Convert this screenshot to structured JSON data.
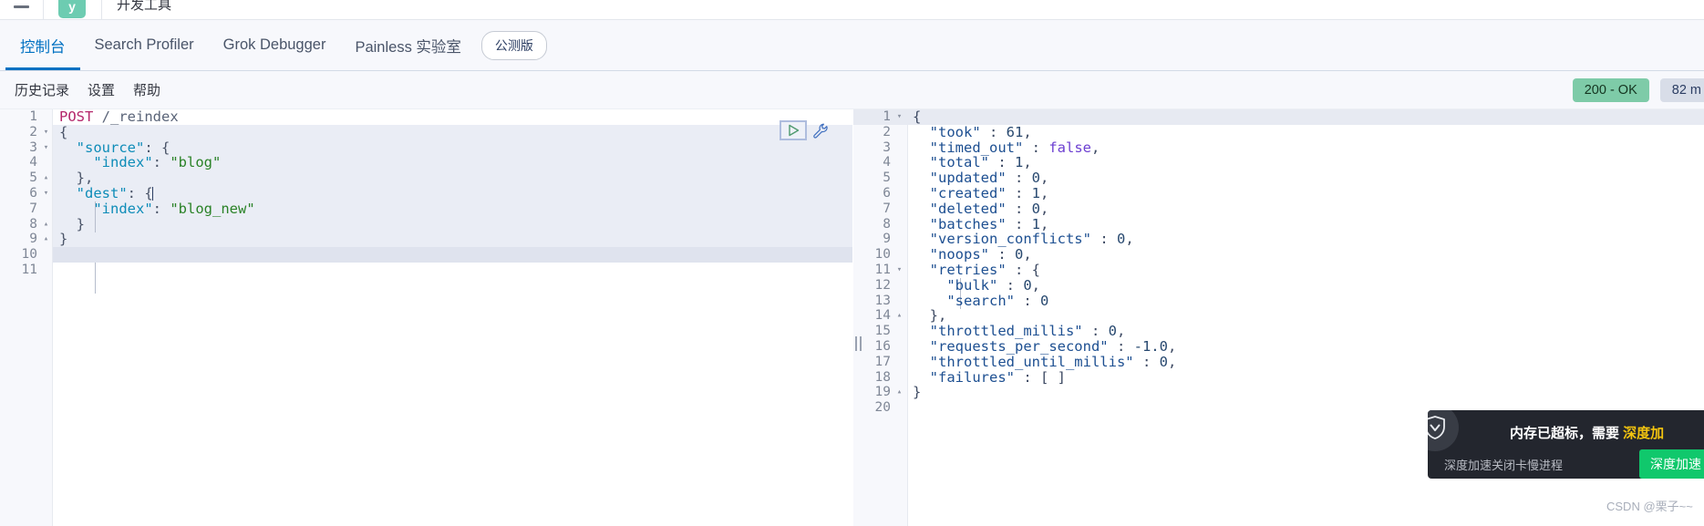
{
  "chrome": {
    "menu_icon": "hamburger-icon",
    "logo_letter": "y",
    "app_title": "开发工具"
  },
  "tabs": [
    {
      "label": "控制台",
      "active": true
    },
    {
      "label": "Search Profiler",
      "active": false
    },
    {
      "label": "Grok Debugger",
      "active": false
    },
    {
      "label": "Painless 实验室",
      "active": false
    }
  ],
  "beta_pill": "公测版",
  "submenu": [
    {
      "label": "历史记录"
    },
    {
      "label": "设置"
    },
    {
      "label": "帮助"
    }
  ],
  "status": {
    "code": "200 - OK",
    "time": "82 m",
    "badge_color": "#7ecba8"
  },
  "request_editor": {
    "play_icon": "play-icon",
    "wrench_icon": "wrench-icon",
    "line_count": 11,
    "current_line": 6,
    "lines": [
      {
        "n": "1",
        "fold": "",
        "tokens": [
          {
            "t": "POST",
            "c": "k-method"
          },
          {
            "t": " ",
            "c": "k-punct"
          },
          {
            "t": "/_reindex",
            "c": "k-path"
          }
        ]
      },
      {
        "n": "2",
        "fold": "▾",
        "tokens": [
          {
            "t": "{",
            "c": "k-punct"
          }
        ]
      },
      {
        "n": "3",
        "fold": "▾",
        "tokens": [
          {
            "t": "  ",
            "c": "k-punct"
          },
          {
            "t": "\"source\"",
            "c": "k-key"
          },
          {
            "t": ": {",
            "c": "k-punct"
          }
        ]
      },
      {
        "n": "4",
        "fold": "",
        "tokens": [
          {
            "t": "    ",
            "c": "k-punct"
          },
          {
            "t": "\"index\"",
            "c": "k-key"
          },
          {
            "t": ": ",
            "c": "k-punct"
          },
          {
            "t": "\"blog\"",
            "c": "k-str"
          }
        ]
      },
      {
        "n": "5",
        "fold": "▴",
        "tokens": [
          {
            "t": "  },",
            "c": "k-punct"
          }
        ]
      },
      {
        "n": "6",
        "fold": "▾",
        "tokens": [
          {
            "t": "  ",
            "c": "k-punct"
          },
          {
            "t": "\"dest\"",
            "c": "k-key"
          },
          {
            "t": ": {",
            "c": "k-punct"
          }
        ]
      },
      {
        "n": "7",
        "fold": "",
        "tokens": [
          {
            "t": "    ",
            "c": "k-punct"
          },
          {
            "t": "\"index\"",
            "c": "k-key"
          },
          {
            "t": ": ",
            "c": "k-punct"
          },
          {
            "t": "\"blog_new\"",
            "c": "k-str"
          }
        ]
      },
      {
        "n": "8",
        "fold": "▴",
        "tokens": [
          {
            "t": "  }",
            "c": "k-punct"
          }
        ]
      },
      {
        "n": "9",
        "fold": "▴",
        "tokens": [
          {
            "t": "}",
            "c": "k-punct"
          }
        ]
      },
      {
        "n": "10",
        "fold": "",
        "tokens": []
      },
      {
        "n": "11",
        "fold": "",
        "tokens": []
      }
    ]
  },
  "response_editor": {
    "line_count": 20,
    "lines": [
      {
        "n": "1",
        "fold": "▾",
        "tokens": [
          {
            "t": "{",
            "c": "r-punct"
          }
        ]
      },
      {
        "n": "2",
        "fold": "",
        "tokens": [
          {
            "t": "  ",
            "c": "r-punct"
          },
          {
            "t": "\"took\"",
            "c": "r-key"
          },
          {
            "t": " : ",
            "c": "r-punct"
          },
          {
            "t": "61",
            "c": "r-num"
          },
          {
            "t": ",",
            "c": "r-punct"
          }
        ]
      },
      {
        "n": "3",
        "fold": "",
        "tokens": [
          {
            "t": "  ",
            "c": "r-punct"
          },
          {
            "t": "\"timed_out\"",
            "c": "r-key"
          },
          {
            "t": " : ",
            "c": "r-punct"
          },
          {
            "t": "false",
            "c": "r-bool"
          },
          {
            "t": ",",
            "c": "r-punct"
          }
        ]
      },
      {
        "n": "4",
        "fold": "",
        "tokens": [
          {
            "t": "  ",
            "c": "r-punct"
          },
          {
            "t": "\"total\"",
            "c": "r-key"
          },
          {
            "t": " : ",
            "c": "r-punct"
          },
          {
            "t": "1",
            "c": "r-num"
          },
          {
            "t": ",",
            "c": "r-punct"
          }
        ]
      },
      {
        "n": "5",
        "fold": "",
        "tokens": [
          {
            "t": "  ",
            "c": "r-punct"
          },
          {
            "t": "\"updated\"",
            "c": "r-key"
          },
          {
            "t": " : ",
            "c": "r-punct"
          },
          {
            "t": "0",
            "c": "r-num"
          },
          {
            "t": ",",
            "c": "r-punct"
          }
        ]
      },
      {
        "n": "6",
        "fold": "",
        "tokens": [
          {
            "t": "  ",
            "c": "r-punct"
          },
          {
            "t": "\"created\"",
            "c": "r-key"
          },
          {
            "t": " : ",
            "c": "r-punct"
          },
          {
            "t": "1",
            "c": "r-num"
          },
          {
            "t": ",",
            "c": "r-punct"
          }
        ]
      },
      {
        "n": "7",
        "fold": "",
        "tokens": [
          {
            "t": "  ",
            "c": "r-punct"
          },
          {
            "t": "\"deleted\"",
            "c": "r-key"
          },
          {
            "t": " : ",
            "c": "r-punct"
          },
          {
            "t": "0",
            "c": "r-num"
          },
          {
            "t": ",",
            "c": "r-punct"
          }
        ]
      },
      {
        "n": "8",
        "fold": "",
        "tokens": [
          {
            "t": "  ",
            "c": "r-punct"
          },
          {
            "t": "\"batches\"",
            "c": "r-key"
          },
          {
            "t": " : ",
            "c": "r-punct"
          },
          {
            "t": "1",
            "c": "r-num"
          },
          {
            "t": ",",
            "c": "r-punct"
          }
        ]
      },
      {
        "n": "9",
        "fold": "",
        "tokens": [
          {
            "t": "  ",
            "c": "r-punct"
          },
          {
            "t": "\"version_conflicts\"",
            "c": "r-key"
          },
          {
            "t": " : ",
            "c": "r-punct"
          },
          {
            "t": "0",
            "c": "r-num"
          },
          {
            "t": ",",
            "c": "r-punct"
          }
        ]
      },
      {
        "n": "10",
        "fold": "",
        "tokens": [
          {
            "t": "  ",
            "c": "r-punct"
          },
          {
            "t": "\"noops\"",
            "c": "r-key"
          },
          {
            "t": " : ",
            "c": "r-punct"
          },
          {
            "t": "0",
            "c": "r-num"
          },
          {
            "t": ",",
            "c": "r-punct"
          }
        ]
      },
      {
        "n": "11",
        "fold": "▾",
        "tokens": [
          {
            "t": "  ",
            "c": "r-punct"
          },
          {
            "t": "\"retries\"",
            "c": "r-key"
          },
          {
            "t": " : {",
            "c": "r-punct"
          }
        ]
      },
      {
        "n": "12",
        "fold": "",
        "tokens": [
          {
            "t": "    ",
            "c": "r-punct"
          },
          {
            "t": "\"bulk\"",
            "c": "r-key"
          },
          {
            "t": " : ",
            "c": "r-punct"
          },
          {
            "t": "0",
            "c": "r-num"
          },
          {
            "t": ",",
            "c": "r-punct"
          }
        ]
      },
      {
        "n": "13",
        "fold": "",
        "tokens": [
          {
            "t": "    ",
            "c": "r-punct"
          },
          {
            "t": "\"search\"",
            "c": "r-key"
          },
          {
            "t": " : ",
            "c": "r-punct"
          },
          {
            "t": "0",
            "c": "r-num"
          }
        ]
      },
      {
        "n": "14",
        "fold": "▴",
        "tokens": [
          {
            "t": "  },",
            "c": "r-punct"
          }
        ]
      },
      {
        "n": "15",
        "fold": "",
        "tokens": [
          {
            "t": "  ",
            "c": "r-punct"
          },
          {
            "t": "\"throttled_millis\"",
            "c": "r-key"
          },
          {
            "t": " : ",
            "c": "r-punct"
          },
          {
            "t": "0",
            "c": "r-num"
          },
          {
            "t": ",",
            "c": "r-punct"
          }
        ]
      },
      {
        "n": "16",
        "fold": "",
        "tokens": [
          {
            "t": "  ",
            "c": "r-punct"
          },
          {
            "t": "\"requests_per_second\"",
            "c": "r-key"
          },
          {
            "t": " : ",
            "c": "r-punct"
          },
          {
            "t": "-1.0",
            "c": "r-num"
          },
          {
            "t": ",",
            "c": "r-punct"
          }
        ]
      },
      {
        "n": "17",
        "fold": "",
        "tokens": [
          {
            "t": "  ",
            "c": "r-punct"
          },
          {
            "t": "\"throttled_until_millis\"",
            "c": "r-key"
          },
          {
            "t": " : ",
            "c": "r-punct"
          },
          {
            "t": "0",
            "c": "r-num"
          },
          {
            "t": ",",
            "c": "r-punct"
          }
        ]
      },
      {
        "n": "18",
        "fold": "",
        "tokens": [
          {
            "t": "  ",
            "c": "r-punct"
          },
          {
            "t": "\"failures\"",
            "c": "r-key"
          },
          {
            "t": " : [ ]",
            "c": "r-punct"
          }
        ]
      },
      {
        "n": "19",
        "fold": "▴",
        "tokens": [
          {
            "t": "}",
            "c": "r-punct"
          }
        ]
      },
      {
        "n": "20",
        "fold": "",
        "tokens": []
      }
    ]
  },
  "toast": {
    "icon": "shield-icon",
    "title_main": "内存已超标，需要 ",
    "title_highlight": "深度加",
    "subtitle": "深度加速关闭卡慢进程",
    "button_label": "深度加速",
    "accent_color": "#10c86c"
  },
  "watermark": "CSDN @栗子~~"
}
